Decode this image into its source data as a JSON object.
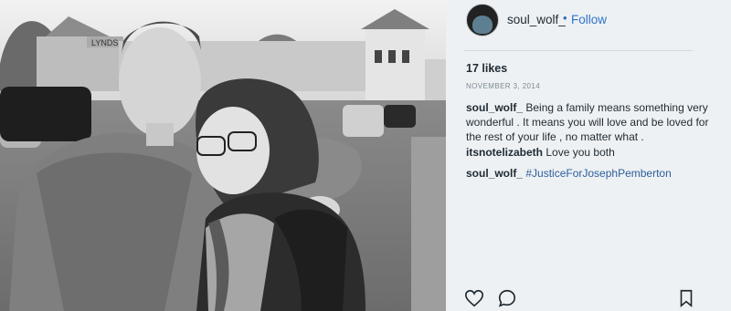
{
  "post": {
    "username": "soul_wolf_",
    "dot": "•",
    "follow_label": "Follow",
    "likes": "17 likes",
    "date": "NOVEMBER 3, 2014",
    "comments": [
      {
        "user": "soul_wolf_",
        "text": "Being a family means something very wonderful . It means you will love and be loved for the rest of your life , no matter what ."
      },
      {
        "user": "itsnotelizabeth",
        "text": "Love you both"
      },
      {
        "user": "soul_wolf_",
        "text": "#JusticeForJosephPemberton"
      }
    ]
  },
  "storefront_sign": "LYNDS",
  "colors": {
    "follow": "#2d74c9",
    "hashtag": "#2c5e9c",
    "text": "#1f2a33"
  },
  "icons": [
    "heart-icon",
    "comment-icon",
    "bookmark-icon"
  ]
}
